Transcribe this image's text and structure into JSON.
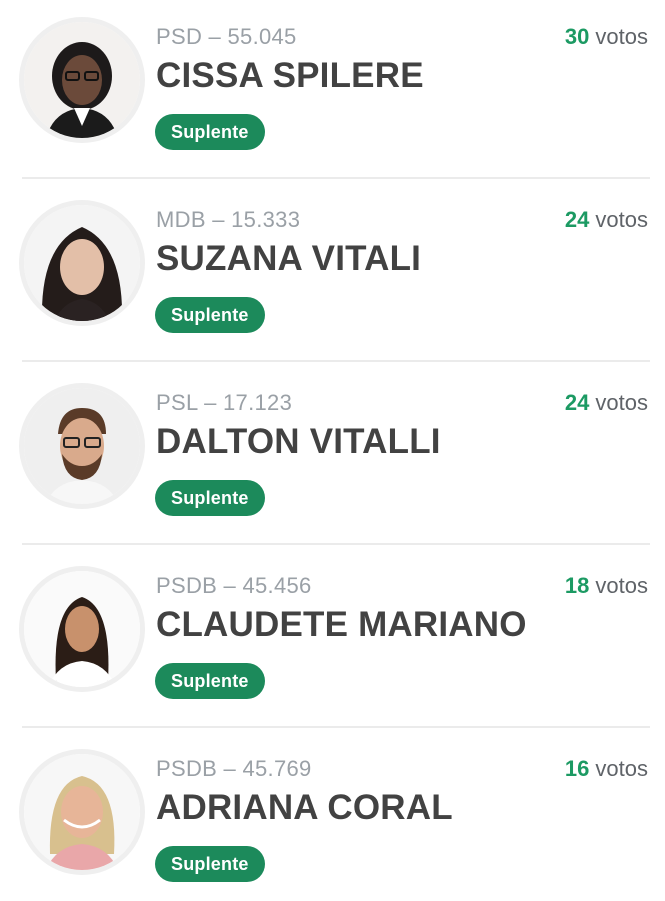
{
  "candidates": [
    {
      "party": "PSD – 55.045",
      "name": "CISSA SPILERE",
      "votes": "30",
      "votes_unit": "votos",
      "status": "Suplente",
      "avatar": "candidate-photo-1"
    },
    {
      "party": "MDB – 15.333",
      "name": "SUZANA VITALI",
      "votes": "24",
      "votes_unit": "votos",
      "status": "Suplente",
      "avatar": "candidate-photo-2"
    },
    {
      "party": "PSL – 17.123",
      "name": "DALTON VITALLI",
      "votes": "24",
      "votes_unit": "votos",
      "status": "Suplente",
      "avatar": "candidate-photo-3"
    },
    {
      "party": "PSDB – 45.456",
      "name": "CLAUDETE MARIANO",
      "votes": "18",
      "votes_unit": "votos",
      "status": "Suplente",
      "avatar": "candidate-photo-4"
    },
    {
      "party": "PSDB – 45.769",
      "name": "ADRIANA CORAL",
      "votes": "16",
      "votes_unit": "votos",
      "status": "Suplente",
      "avatar": "candidate-photo-5"
    }
  ],
  "colors": {
    "accent": "#1c8a5b",
    "votes_number": "#1c9a63",
    "name_text": "#424242",
    "party_text": "#9aa0a6",
    "divider": "#ebebeb"
  }
}
